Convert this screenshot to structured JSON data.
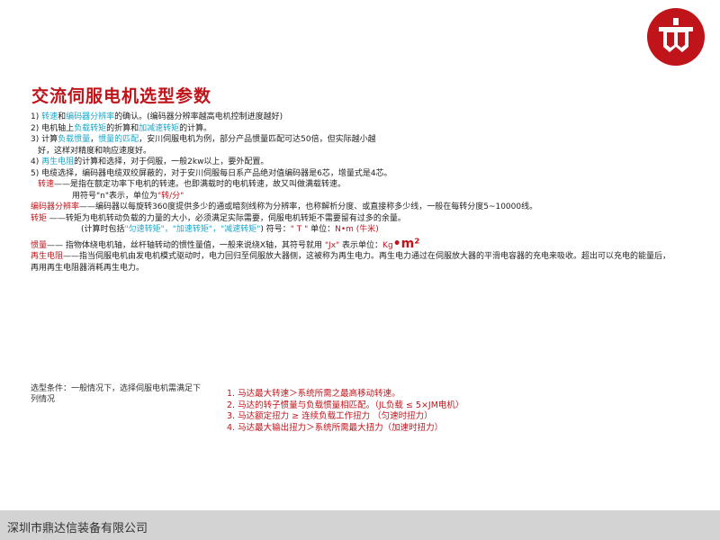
{
  "title": "交流伺服电机选型参数",
  "lines": {
    "l1": {
      "a": "1)  ",
      "b": "转速",
      "c": "和",
      "d": "编码器分辨率",
      "e": "的确认。(编码器分辨率越高电机控制进度越好)"
    },
    "l2": {
      "a": "2)  电机轴上",
      "b": "负载转矩",
      "c": "的折算和",
      "d": "加减速转矩",
      "e": "的计算。"
    },
    "l3": {
      "a": "3)  计算",
      "b": "负载惯量",
      "c": "，",
      "d": "惯量的匹配",
      "e": "，安川伺服电机为例，部分产品惯量匹配可达50倍，但实际越小越"
    },
    "l3b": "好，这样对精度和响应速度好。",
    "l4": {
      "a": "4)  ",
      "b": "再生电阻",
      "c": "的计算和选择，对于伺服，一般2kw以上，要外配置。"
    },
    "l5": "5)     电缆选择，编码器电缆双绞屏蔽的，对于安川伺服每日系产品绝对值编码器是6芯，增量式是4芯。",
    "l6": {
      "a": "转速",
      "b": "——是指在额定功率下电机的转速。也即满载时的电机转速，故又叫做满载转速。"
    },
    "l7": {
      "a": "用符号\"n\"表示，单位为",
      "b": "\"转/分\""
    },
    "l8": {
      "a": "编码器分辨率",
      "b": "——编码器以每旋转360度提供多少的通或暗刻线称为分辨率，也称解析分度、或直接称多少线，一般在每转分度5~10000线。"
    },
    "l9": {
      "a": "转矩 ",
      "b": "——转矩为电机转动负载的力量的大小，必须满足实际需要，伺服电机转矩不需要留有过多的余量。"
    },
    "l10": {
      "a": "(计算时包括",
      "b": "\"匀速转矩\"，\"加速转矩\"，\"减速转矩\"",
      "c": ")  符号：",
      "d": "\" T \"",
      "e": "  单位：",
      "f": "N•m (牛米)"
    },
    "l11": {
      "a": "惯量",
      "b": "—— 指物体绕电机轴，丝杆轴转动的惯性量值，一般来说绕X轴，其符号就用 ",
      "c": "\"Jx\"",
      "d": " 表示单位：",
      "e": "Kg",
      "f": "•m²"
    },
    "l12": {
      "a": "再生电阻",
      "b": "——指当伺服电机由发电机模式驱动时，电力回归至伺服放大器侧，这被称为再生电力。再生电力通过在伺服放大器的平滑电容器的充电来吸收。超出可以充电的能量后，再用再生电阻器消耗再生电力。"
    }
  },
  "condition": "选型条件：一般情况下，选择伺服电机需满足下列情况",
  "criteria": [
    "1. 马达最大转速＞系统所需之最高移动转速。",
    "2. 马达的转子惯量与负载惯量相匹配。（JL负载 ≤ 5×JM电机）",
    "3. 马达额定扭力  ≥ 连续负载工作扭力 （匀速时扭力）",
    "4. 马达最大输出扭力＞系统所需最大扭力（加速时扭力）"
  ],
  "footer": "深圳市鼎达信装备有限公司",
  "colors": {
    "brand_red": "#c0141b",
    "highlight_cyan": "#1aa6c8",
    "footer_gray": "#d3d3d3"
  }
}
